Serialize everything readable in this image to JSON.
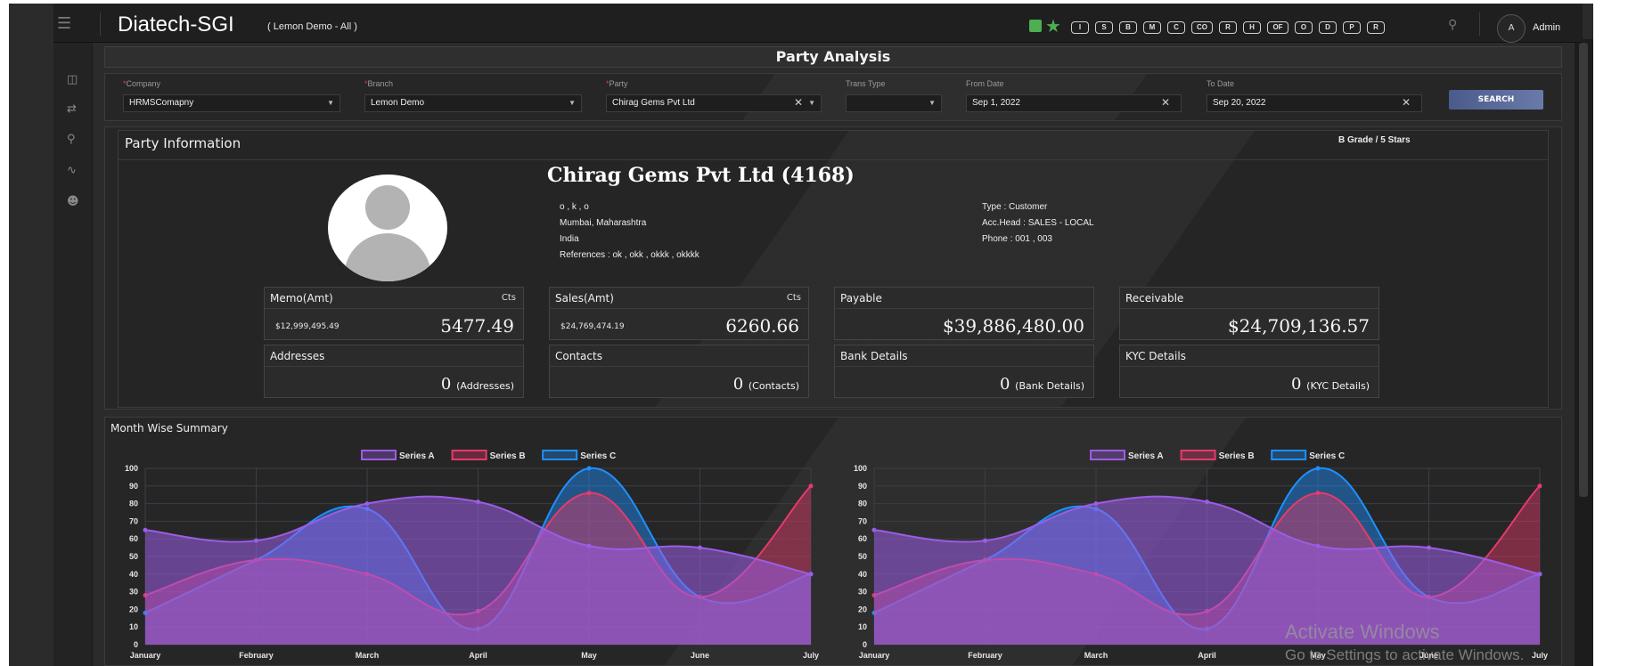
{
  "app": {
    "brand": "Diatech-SGI",
    "context": "( Lemon Demo - All )",
    "user_initial": "A",
    "user_name": "Admin",
    "quick_buttons": [
      "I",
      "S",
      "B",
      "M",
      "C",
      "CO",
      "R",
      "H",
      "OF",
      "O",
      "D",
      "P",
      "R"
    ]
  },
  "sidebar": {
    "icons": [
      "menu-icon",
      "dashboard-icon",
      "transfer-icon",
      "search-icon",
      "activity-icon",
      "user-icon"
    ]
  },
  "page": {
    "title": "Party Analysis"
  },
  "filters": {
    "company": {
      "label": "Company",
      "value": "HRMSComapny"
    },
    "branch": {
      "label": "Branch",
      "value": "Lemon Demo"
    },
    "party": {
      "label": "Party",
      "value": "Chirag Gems Pvt Ltd"
    },
    "trans_type": {
      "label": "Trans Type",
      "value": ""
    },
    "from_date": {
      "label": "From Date",
      "value": "Sep 1, 2022"
    },
    "to_date": {
      "label": "To Date",
      "value": "Sep 20, 2022"
    },
    "search_label": "SEARCH",
    "required_mark": "*"
  },
  "party_info": {
    "section_title": "Party Information",
    "grade": "B Grade / 5 Stars",
    "name": "Chirag Gems Pvt Ltd (4168)",
    "address_lines": [
      "o , k , o",
      "Mumbai, Maharashtra",
      "India",
      "References : ok , okk , okkk , okkkk"
    ],
    "meta_lines": [
      "Type : Customer",
      "Acc.Head : SALES - LOCAL",
      "Phone : 001 , 003"
    ]
  },
  "stats": {
    "memo": {
      "title": "Memo(Amt)",
      "unit": "Cts",
      "amount": "$12,999,495.49",
      "value": "5477.49"
    },
    "sales": {
      "title": "Sales(Amt)",
      "unit": "Cts",
      "amount": "$24,769,474.19",
      "value": "6260.66"
    },
    "payable": {
      "title": "Payable",
      "value": "$39,886,480.00"
    },
    "receivable": {
      "title": "Receivable",
      "value": "$24,709,136.57"
    },
    "addresses": {
      "title": "Addresses",
      "count": "0",
      "suffix": "(Addresses)"
    },
    "contacts": {
      "title": "Contacts",
      "count": "0",
      "suffix": "(Contacts)"
    },
    "bank": {
      "title": "Bank Details",
      "count": "0",
      "suffix": "(Bank Details)"
    },
    "kyc": {
      "title": "KYC Details",
      "count": "0",
      "suffix": "(KYC Details)"
    }
  },
  "summary": {
    "title": "Month Wise Summary"
  },
  "colors": {
    "series_a": "#9b5de5",
    "series_b": "#e63a6b",
    "series_c": "#1e90ff"
  },
  "chart_data": [
    {
      "type": "area",
      "categories": [
        "January",
        "February",
        "March",
        "April",
        "May",
        "June",
        "July"
      ],
      "ylim": [
        0,
        100
      ],
      "yticks": [
        0,
        10,
        20,
        30,
        40,
        50,
        60,
        70,
        80,
        90,
        100
      ],
      "grid": true,
      "legend": "top-center",
      "series": [
        {
          "name": "Series A",
          "values": [
            65,
            59,
            80,
            81,
            56,
            55,
            40
          ]
        },
        {
          "name": "Series B",
          "values": [
            28,
            48,
            40,
            19,
            86,
            27,
            90
          ]
        },
        {
          "name": "Series C",
          "values": [
            18,
            48,
            77,
            9,
            100,
            27,
            40
          ]
        }
      ]
    },
    {
      "type": "area",
      "categories": [
        "January",
        "February",
        "March",
        "April",
        "May",
        "June",
        "July"
      ],
      "ylim": [
        0,
        100
      ],
      "yticks": [
        0,
        10,
        20,
        30,
        40,
        50,
        60,
        70,
        80,
        90,
        100
      ],
      "grid": true,
      "legend": "top-center",
      "series": [
        {
          "name": "Series A",
          "values": [
            65,
            59,
            80,
            81,
            56,
            55,
            40
          ]
        },
        {
          "name": "Series B",
          "values": [
            28,
            48,
            40,
            19,
            86,
            27,
            90
          ]
        },
        {
          "name": "Series C",
          "values": [
            18,
            48,
            77,
            9,
            100,
            27,
            40
          ]
        }
      ]
    }
  ],
  "watermark": {
    "line1": "Activate Windows",
    "line2": "Go to Settings to activate Windows."
  }
}
